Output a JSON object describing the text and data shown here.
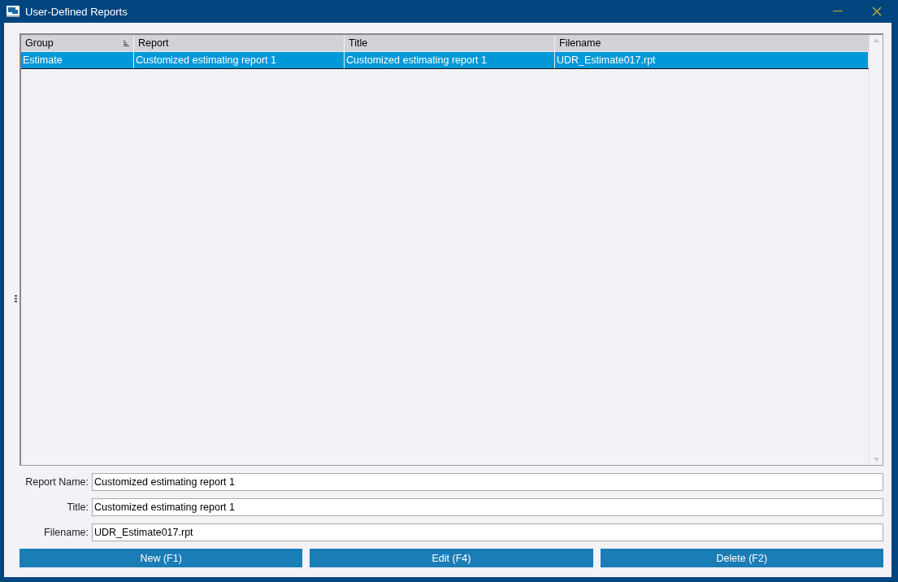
{
  "window": {
    "title": "User-Defined Reports"
  },
  "table": {
    "columns": [
      {
        "label": "Group",
        "sorted": true
      },
      {
        "label": "Report",
        "sorted": false
      },
      {
        "label": "Title",
        "sorted": false
      },
      {
        "label": "Filename",
        "sorted": false
      }
    ],
    "rows": [
      {
        "cells": [
          "Estimate",
          "Customized estimating report 1",
          "Customized estimating report 1",
          "UDR_Estimate017.rpt"
        ],
        "selected": true
      }
    ]
  },
  "form": [
    {
      "label": "Report Name:",
      "value": "Customized estimating report 1"
    },
    {
      "label": "Title:",
      "value": "Customized estimating report 1"
    },
    {
      "label": "Filename:",
      "value": "UDR_Estimate017.rpt"
    }
  ],
  "buttons": [
    "New (F1)",
    "Edit (F4)",
    "Delete (F2)"
  ]
}
